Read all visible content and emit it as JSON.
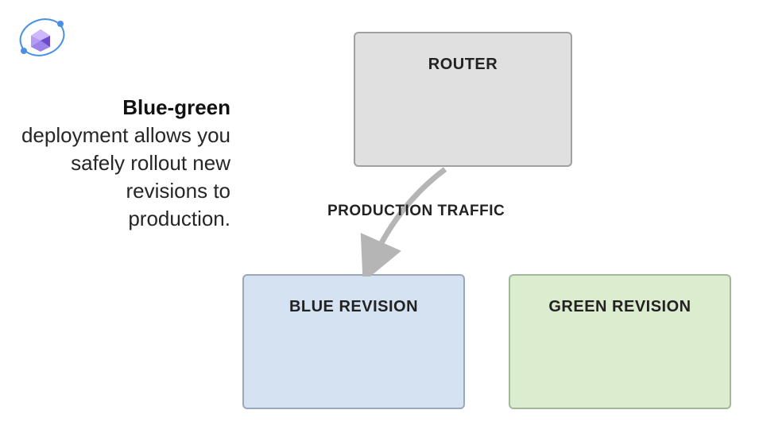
{
  "description": {
    "bold": "Blue-green",
    "rest": " deployment allows you safely rollout new revisions to production."
  },
  "boxes": {
    "router": "ROUTER",
    "blue": "BLUE REVISION",
    "green": "GREEN REVISION"
  },
  "arrow_label": "PRODUCTION TRAFFIC",
  "colors": {
    "router_bg": "#e0e0e0",
    "blue_bg": "#d5e2f2",
    "green_bg": "#dceccf",
    "arrow": "#b5b5b5",
    "icon_primary": "#7b61d6",
    "icon_accent": "#4a90e2"
  }
}
